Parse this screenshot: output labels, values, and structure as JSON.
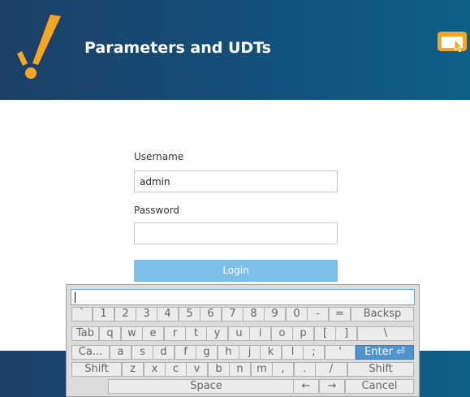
{
  "header": {
    "title": "Parameters and UDTs"
  },
  "login": {
    "username_label": "Username",
    "username_value": "admin",
    "password_label": "Password",
    "password_value": "",
    "login_button": "Login"
  },
  "keyboard": {
    "input_value": "",
    "rows": [
      [
        "`",
        "1",
        "2",
        "3",
        "4",
        "5",
        "6",
        "7",
        "8",
        "9",
        "0",
        "-",
        "=",
        "Backsp"
      ],
      [
        "Tab",
        "q",
        "w",
        "e",
        "r",
        "t",
        "y",
        "u",
        "i",
        "o",
        "p",
        "[",
        "]",
        "\\"
      ],
      [
        "Ca...",
        "a",
        "s",
        "d",
        "f",
        "g",
        "h",
        "j",
        "k",
        "l",
        ";",
        "'",
        "Enter ⏎"
      ],
      [
        "Shift",
        "z",
        "x",
        "c",
        "v",
        "b",
        "n",
        "m",
        ",",
        ".",
        "/",
        "Shift"
      ],
      [
        "Space",
        "←",
        "→",
        "Cancel"
      ]
    ]
  },
  "colors": {
    "header_start": "#1c3f66",
    "header_end": "#0e5f88",
    "logo_orange": "#f5a623",
    "login_button": "#7cc0ea",
    "enter_key": "#4f93cf"
  },
  "icons": {
    "logo": "checkmark-logo-icon",
    "window": "window-cursor-icon"
  }
}
